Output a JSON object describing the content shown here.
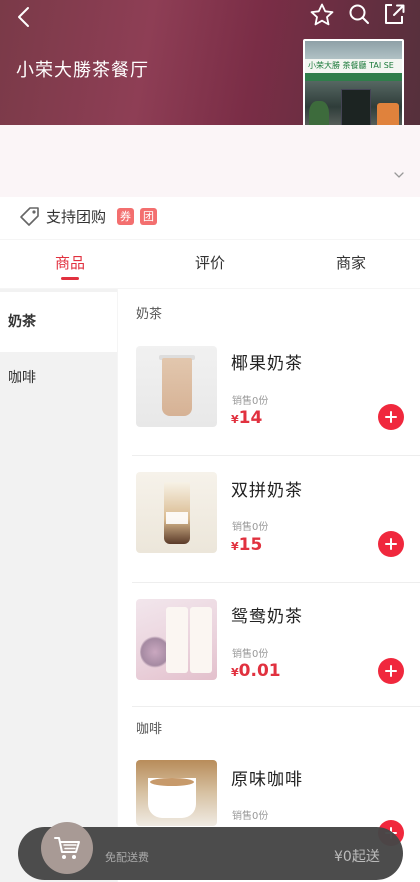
{
  "shop": {
    "name": "小荣大勝茶餐厅",
    "photo_sign": "小荣大勝 茶餐廳 TAI SE"
  },
  "promo": {
    "text": "支持团购",
    "badges": [
      "券",
      "团"
    ]
  },
  "tabs": [
    {
      "label": "商品",
      "active": true
    },
    {
      "label": "评价"
    },
    {
      "label": "商家"
    }
  ],
  "categories": [
    {
      "label": "奶茶",
      "active": true
    },
    {
      "label": "咖啡"
    }
  ],
  "sections": [
    {
      "title": "奶茶",
      "items": [
        {
          "name": "椰果奶茶",
          "sales": "销售0份",
          "currency": "¥",
          "price": "14"
        },
        {
          "name": "双拼奶茶",
          "sales": "销售0份",
          "currency": "¥",
          "price": "15"
        },
        {
          "name": "鸳鸯奶茶",
          "sales": "销售0份",
          "currency": "¥",
          "price": "0.01"
        }
      ]
    },
    {
      "title": "咖啡",
      "items": [
        {
          "name": "原味咖啡",
          "sales": "销售0份"
        }
      ]
    }
  ],
  "cart": {
    "delivery_text": "免配送费",
    "min_order": "¥0起送"
  },
  "colors": {
    "accent": "#e1313f",
    "add_button": "#f0283d",
    "badge": "#f36f6f"
  },
  "icons": {
    "back": "chevron-left-icon",
    "favorite": "star-outline-icon",
    "search": "search-icon",
    "share": "share-icon",
    "tag": "tag-icon",
    "expand": "chevron-down-icon",
    "cart": "shopping-cart-icon",
    "add": "plus-icon"
  }
}
